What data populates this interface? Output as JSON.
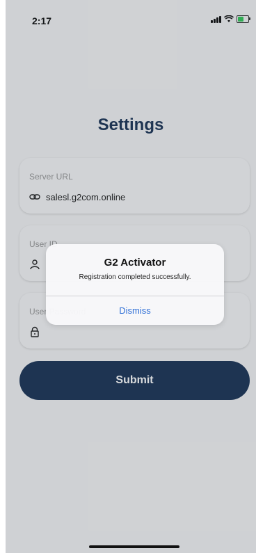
{
  "status_bar": {
    "time": "2:17"
  },
  "header": {
    "title": "Settings"
  },
  "fields": [
    {
      "label": "Server URL",
      "value": "salesl.g2com.online",
      "icon": "link-icon"
    },
    {
      "label": "User ID",
      "value": "",
      "icon": "person-icon"
    },
    {
      "label": "User Password",
      "value": "",
      "icon": "lock-icon"
    }
  ],
  "submit": {
    "label": "Submit"
  },
  "alert": {
    "title": "G2 Activator",
    "message": "Registration completed successfully.",
    "dismiss_label": "Dismiss"
  },
  "colors": {
    "primary": "#1d3557",
    "alert_action": "#2f6fd6",
    "battery_charging": "#34c759"
  }
}
